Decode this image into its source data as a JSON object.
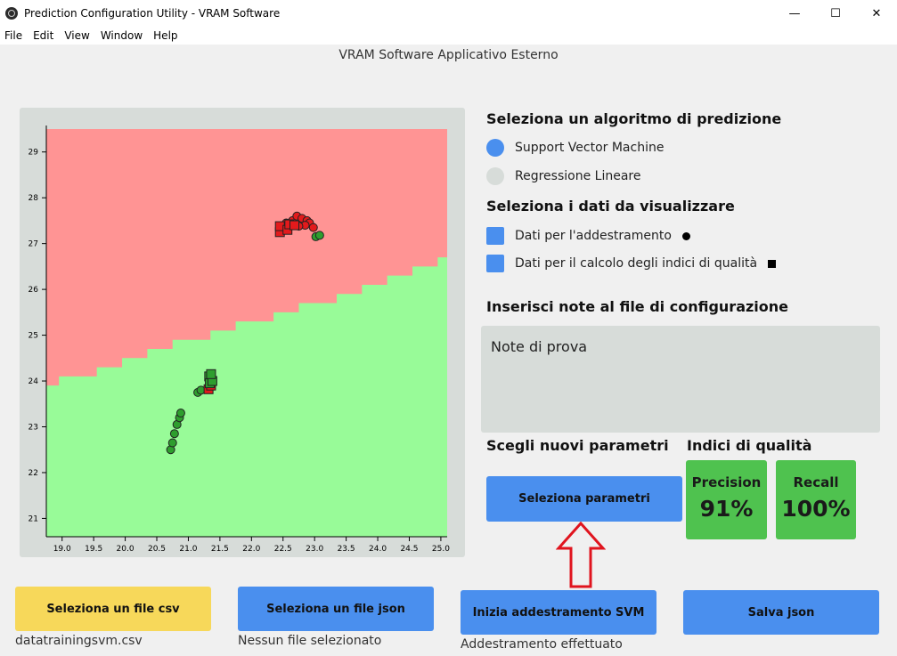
{
  "window": {
    "title": "Prediction Configuration Utility - VRAM Software",
    "minimize": "—",
    "maximize": "☐",
    "close": "✕"
  },
  "menu": [
    "File",
    "Edit",
    "View",
    "Window",
    "Help"
  ],
  "header": "VRAM Software Applicativo Esterno",
  "algorithm": {
    "title": "Seleziona un algoritmo di predizione",
    "options": [
      {
        "label": "Support Vector Machine",
        "selected": true
      },
      {
        "label": "Regressione Lineare",
        "selected": false
      }
    ]
  },
  "data_selection": {
    "title": "Seleziona i dati da visualizzare",
    "options": [
      {
        "label": "Dati per l'addestramento",
        "marker": "circle",
        "checked": true
      },
      {
        "label": "Dati per il calcolo degli indici di qualità",
        "marker": "square",
        "checked": true
      }
    ]
  },
  "notes": {
    "title": "Inserisci note al file di configurazione",
    "value": "Note di prova"
  },
  "parameters": {
    "title": "Scegli nuovi parametri",
    "button": "Seleziona parametri"
  },
  "quality": {
    "title": "Indici di qualità",
    "precision_label": "Precision",
    "precision_value": "91%",
    "recall_label": "Recall",
    "recall_value": "100%"
  },
  "actions": {
    "csv_button": "Seleziona un file csv",
    "csv_status": "datatrainingsvm.csv",
    "json_button": "Seleziona un file json",
    "json_status": "Nessun file selezionato",
    "train_button": "Inizia addestramento SVM",
    "train_status": "Addestramento effettuato",
    "save_button": "Salva json"
  },
  "colors": {
    "accent_blue": "#4a8fee",
    "region_red": "#ff9494",
    "region_green": "#98fb98",
    "point_red": "#e31a1c",
    "point_green": "#2e9e2e",
    "metric_green": "#4fc24f",
    "yellow": "#f7d85a",
    "radio_off": "#d7dcd9",
    "arrow_red": "#e0141e"
  },
  "chart_data": {
    "type": "scatter",
    "xlim": [
      18.75,
      25.1
    ],
    "ylim": [
      20.6,
      29.5
    ],
    "xticks": [
      "19.0",
      "19.5",
      "20.0",
      "20.5",
      "21.0",
      "21.5",
      "22.0",
      "22.5",
      "23.0",
      "23.5",
      "24.0",
      "24.5",
      "25.0"
    ],
    "yticks": [
      "21",
      "22",
      "23",
      "24",
      "25",
      "26",
      "27",
      "28",
      "29"
    ],
    "boundary": [
      [
        18.75,
        23.9
      ],
      [
        18.95,
        24.1
      ],
      [
        19.55,
        24.3
      ],
      [
        19.95,
        24.5
      ],
      [
        20.35,
        24.7
      ],
      [
        20.75,
        24.9
      ],
      [
        21.35,
        25.1
      ],
      [
        21.75,
        25.3
      ],
      [
        22.35,
        25.5
      ],
      [
        22.75,
        25.7
      ],
      [
        23.35,
        25.9
      ],
      [
        23.75,
        26.1
      ],
      [
        24.15,
        26.3
      ],
      [
        24.55,
        26.5
      ],
      [
        24.95,
        26.7
      ],
      [
        25.1,
        26.7
      ]
    ],
    "series": [
      {
        "marker": "circle",
        "color": "red",
        "points": [
          [
            22.55,
            27.45
          ],
          [
            22.65,
            27.5
          ],
          [
            22.72,
            27.6
          ],
          [
            22.8,
            27.55
          ],
          [
            22.88,
            27.5
          ],
          [
            22.92,
            27.45
          ],
          [
            22.98,
            27.35
          ],
          [
            22.85,
            27.4
          ],
          [
            22.75,
            27.38
          ]
        ]
      },
      {
        "marker": "circle",
        "color": "green",
        "points": [
          [
            23.02,
            27.15
          ],
          [
            23.08,
            27.18
          ],
          [
            20.72,
            22.5
          ],
          [
            20.75,
            22.65
          ],
          [
            20.78,
            22.85
          ],
          [
            20.82,
            23.05
          ],
          [
            20.86,
            23.2
          ],
          [
            20.88,
            23.3
          ],
          [
            21.15,
            23.75
          ],
          [
            21.2,
            23.8
          ]
        ]
      },
      {
        "marker": "square",
        "color": "red",
        "points": [
          [
            22.45,
            27.25
          ],
          [
            22.45,
            27.38
          ],
          [
            22.57,
            27.3
          ],
          [
            22.6,
            27.42
          ],
          [
            22.68,
            27.4
          ],
          [
            21.32,
            23.82
          ],
          [
            21.36,
            23.9
          ]
        ]
      },
      {
        "marker": "square",
        "color": "green",
        "points": [
          [
            21.33,
            24.1
          ],
          [
            21.34,
            23.95
          ],
          [
            21.38,
            24.0
          ],
          [
            21.36,
            24.15
          ]
        ]
      }
    ]
  }
}
